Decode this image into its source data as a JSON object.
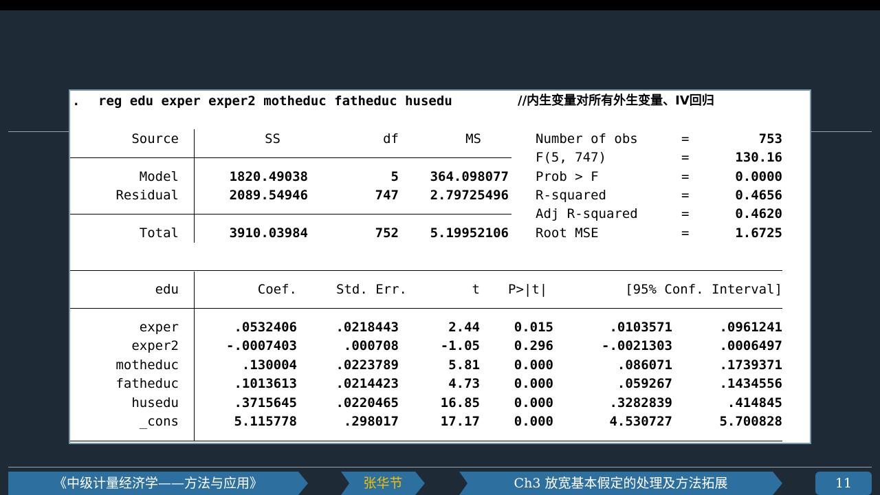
{
  "command": {
    "prefix": ".",
    "text": "reg edu exper exper2 motheduc fatheduc husedu",
    "comment": "//内生变量对所有外生变量、IV回归"
  },
  "anova": {
    "headers": [
      "Source",
      "SS",
      "df",
      "MS"
    ],
    "rows": [
      {
        "source": "Model",
        "ss": "1820.49038",
        "df": "5",
        "ms": "364.098077"
      },
      {
        "source": "Residual",
        "ss": "2089.54946",
        "df": "747",
        "ms": "2.79725496"
      },
      {
        "source": "Total",
        "ss": "3910.03984",
        "df": "752",
        "ms": "5.19952106"
      }
    ]
  },
  "stats": [
    {
      "label": "Number of obs",
      "eq": "=",
      "value": "753"
    },
    {
      "label": "F(5, 747)",
      "eq": "=",
      "value": "130.16"
    },
    {
      "label": "Prob > F",
      "eq": "=",
      "value": "0.0000"
    },
    {
      "label": "R-squared",
      "eq": "=",
      "value": "0.4656"
    },
    {
      "label": "Adj R-squared",
      "eq": "=",
      "value": "0.4620"
    },
    {
      "label": "Root MSE",
      "eq": "=",
      "value": "1.6725"
    }
  ],
  "coef": {
    "headers": [
      "edu",
      "Coef.",
      "Std. Err.",
      "t",
      "P>|t|",
      "[95% Conf. Interval]"
    ],
    "rows": [
      {
        "var": "exper",
        "coef": ".0532406",
        "se": ".0218443",
        "t": "2.44",
        "p": "0.015",
        "lo": ".0103571",
        "hi": ".0961241"
      },
      {
        "var": "exper2",
        "coef": "-.0007403",
        "se": ".000708",
        "t": "-1.05",
        "p": "0.296",
        "lo": "-.0021303",
        "hi": ".0006497"
      },
      {
        "var": "motheduc",
        "coef": ".130004",
        "se": ".0223789",
        "t": "5.81",
        "p": "0.000",
        "lo": ".086071",
        "hi": ".1739371"
      },
      {
        "var": "fatheduc",
        "coef": ".1013613",
        "se": ".0214423",
        "t": "4.73",
        "p": "0.000",
        "lo": ".059267",
        "hi": ".1434556"
      },
      {
        "var": "husedu",
        "coef": ".3715645",
        "se": ".0220465",
        "t": "16.85",
        "p": "0.000",
        "lo": ".3282839",
        "hi": ".414845"
      },
      {
        "var": "_cons",
        "coef": "5.115778",
        "se": ".298017",
        "t": "17.17",
        "p": "0.000",
        "lo": "4.530727",
        "hi": "5.700828"
      }
    ]
  },
  "footer": {
    "course": "《中级计量经济学——方法与应用》",
    "author": "张华节",
    "chapter": "Ch3 放宽基本假定的处理及方法拓展",
    "page": "11"
  },
  "colors": {
    "background": "#1e2a35",
    "footer_segment": "#2d6f9e",
    "author_text": "#f2c100",
    "panel_border": "#7b97ab"
  }
}
